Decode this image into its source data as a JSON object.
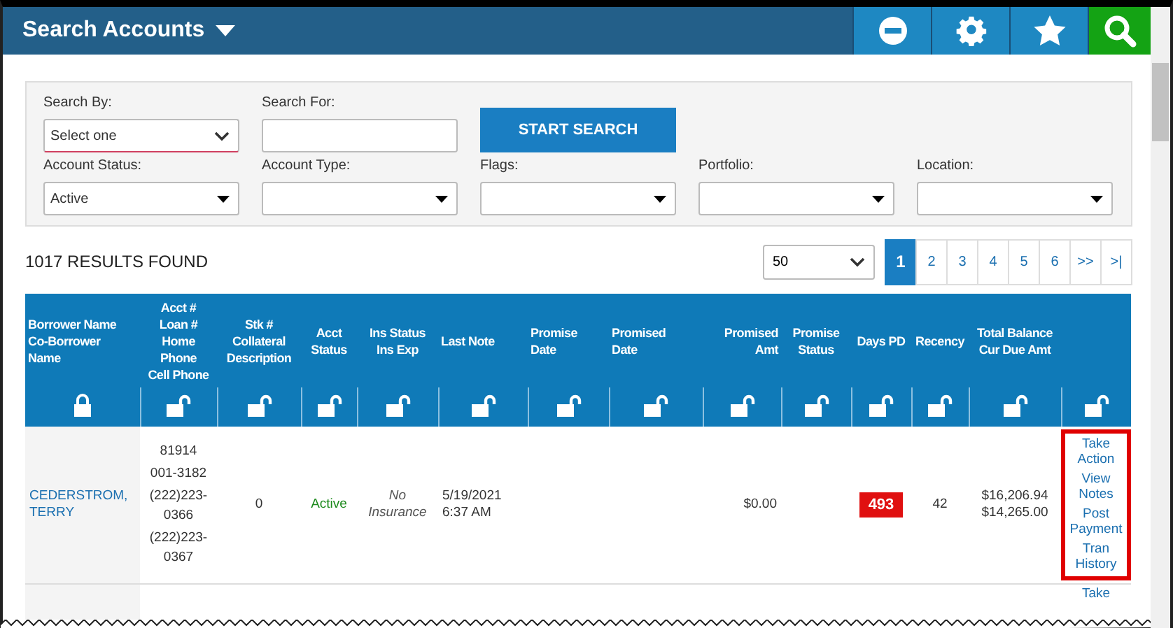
{
  "header": {
    "title": "Search Accounts",
    "buttons": [
      {
        "kind": "minus"
      },
      {
        "kind": "gear"
      },
      {
        "kind": "star"
      },
      {
        "kind": "search",
        "selected": true
      }
    ]
  },
  "search_panel": {
    "search_by": {
      "label": "Search By:",
      "value": "Select one"
    },
    "search_for": {
      "label": "Search For:"
    },
    "start_button": "START SEARCH",
    "filters": [
      {
        "label": "Account Status:",
        "value": "Active"
      },
      {
        "label": "Account Type:"
      },
      {
        "label": "Flags:"
      },
      {
        "label": "Portfolio:"
      },
      {
        "label": "Location:"
      }
    ]
  },
  "results": {
    "count": "1017 RESULTS FOUND",
    "page_size": "50",
    "pages": [
      {
        "label": "1",
        "selected": true
      },
      {
        "label": "2",
        "selected": false
      },
      {
        "label": "3",
        "selected": false
      },
      {
        "label": "4",
        "selected": false
      },
      {
        "label": "5",
        "selected": false
      },
      {
        "label": "6",
        "selected": false
      },
      {
        "label": ">>",
        "selected": false
      },
      {
        "label": ">|",
        "selected": false
      }
    ]
  },
  "table": {
    "columns": [
      {
        "lines": [
          "Borrower Name",
          "Co-Borrower",
          "Name"
        ],
        "locked": true
      },
      {
        "lines": [
          "Acct #",
          "Loan #",
          "Home",
          "Phone",
          "Cell Phone"
        ],
        "locked": false
      },
      {
        "lines": [
          "Stk #",
          "Collateral",
          "Description"
        ],
        "locked": false
      },
      {
        "lines": [
          "Acct",
          "Status"
        ],
        "locked": false
      },
      {
        "lines": [
          "Ins Status",
          "Ins Exp"
        ],
        "locked": false
      },
      {
        "lines": [
          "Last Note"
        ],
        "locked": false
      },
      {
        "lines": [
          "Promise",
          "Date"
        ],
        "locked": false
      },
      {
        "lines": [
          "Promised",
          "Date"
        ],
        "locked": false
      },
      {
        "lines": [
          "Promised",
          "Amt"
        ],
        "locked": false
      },
      {
        "lines": [
          "Promise",
          "Status"
        ],
        "locked": false
      },
      {
        "lines": [
          "Days PD"
        ],
        "locked": false
      },
      {
        "lines": [
          "Recency"
        ],
        "locked": false
      },
      {
        "lines": [
          "Total Balance",
          "Cur Due Amt"
        ],
        "locked": false
      },
      {
        "locked": false
      }
    ],
    "rows": [
      {
        "borrower": "CEDERSTROM, TERRY",
        "account_lines": [
          "81914",
          "001-3182",
          "(222)223-0366",
          "(222)223-0367"
        ],
        "stock": "0",
        "status": "Active",
        "insurance": "No Insurance",
        "last_note": "5/19/2021 6:37 AM",
        "promised_amt": "$0.00",
        "days_pd": "493",
        "recency": "42",
        "balances": [
          "$16,206.94",
          "$14,265.00"
        ],
        "actions": [
          "Take Action",
          "View Notes",
          "Post Payment",
          "Tran History"
        ],
        "highlighted": true
      },
      {
        "actions": [
          "Take"
        ]
      }
    ]
  }
}
